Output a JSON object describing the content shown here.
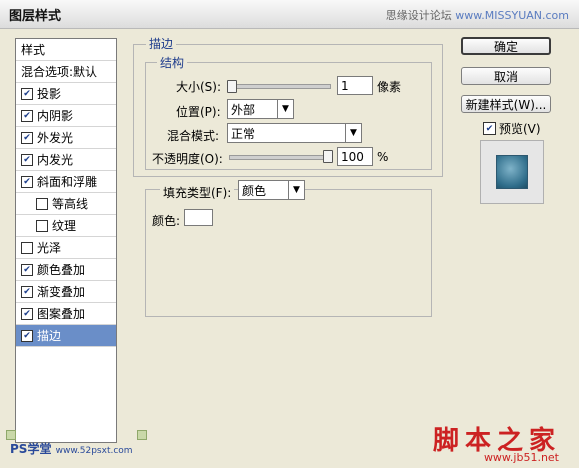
{
  "title": "图层样式",
  "watermark_top": {
    "text": "思缘设计论坛",
    "url": "www.MISSYUAN.com"
  },
  "style_list": {
    "header": "样式",
    "items": [
      {
        "label": "混合选项:默认",
        "checkbox": false,
        "checked": false,
        "indent": false,
        "selected": false
      },
      {
        "label": "投影",
        "checkbox": true,
        "checked": true,
        "indent": false,
        "selected": false
      },
      {
        "label": "内阴影",
        "checkbox": true,
        "checked": true,
        "indent": false,
        "selected": false
      },
      {
        "label": "外发光",
        "checkbox": true,
        "checked": true,
        "indent": false,
        "selected": false
      },
      {
        "label": "内发光",
        "checkbox": true,
        "checked": true,
        "indent": false,
        "selected": false
      },
      {
        "label": "斜面和浮雕",
        "checkbox": true,
        "checked": true,
        "indent": false,
        "selected": false
      },
      {
        "label": "等高线",
        "checkbox": true,
        "checked": false,
        "indent": true,
        "selected": false
      },
      {
        "label": "纹理",
        "checkbox": true,
        "checked": false,
        "indent": true,
        "selected": false
      },
      {
        "label": "光泽",
        "checkbox": true,
        "checked": false,
        "indent": false,
        "selected": false
      },
      {
        "label": "颜色叠加",
        "checkbox": true,
        "checked": true,
        "indent": false,
        "selected": false
      },
      {
        "label": "渐变叠加",
        "checkbox": true,
        "checked": true,
        "indent": false,
        "selected": false
      },
      {
        "label": "图案叠加",
        "checkbox": true,
        "checked": true,
        "indent": false,
        "selected": false
      },
      {
        "label": "描边",
        "checkbox": true,
        "checked": true,
        "indent": false,
        "selected": true
      }
    ]
  },
  "stroke_panel": {
    "title": "描边",
    "structure": {
      "title": "结构",
      "size_label": "大小(S):",
      "size_value": "1",
      "size_unit": "像素",
      "position_label": "位置(P):",
      "position_value": "外部",
      "blend_label": "混合模式:",
      "blend_value": "正常",
      "opacity_label": "不透明度(O):",
      "opacity_value": "100",
      "opacity_unit": "%",
      "size_slider_fraction": 0.0,
      "opacity_slider_fraction": 1.0
    },
    "fill_type_label": "填充类型(F):",
    "fill_type_value": "颜色",
    "color_label": "颜色:",
    "color_swatch": "#ffffff"
  },
  "buttons": {
    "ok": "确定",
    "cancel": "取消",
    "new_style": "新建样式(W)..."
  },
  "preview": {
    "label": "预览(V)",
    "checked": true
  },
  "watermark_bottom_left": {
    "text": "PS学堂",
    "small": "www.52psxt.com"
  },
  "watermark_bottom_right": {
    "text": "脚本之家",
    "url": "www.jb51.net"
  }
}
